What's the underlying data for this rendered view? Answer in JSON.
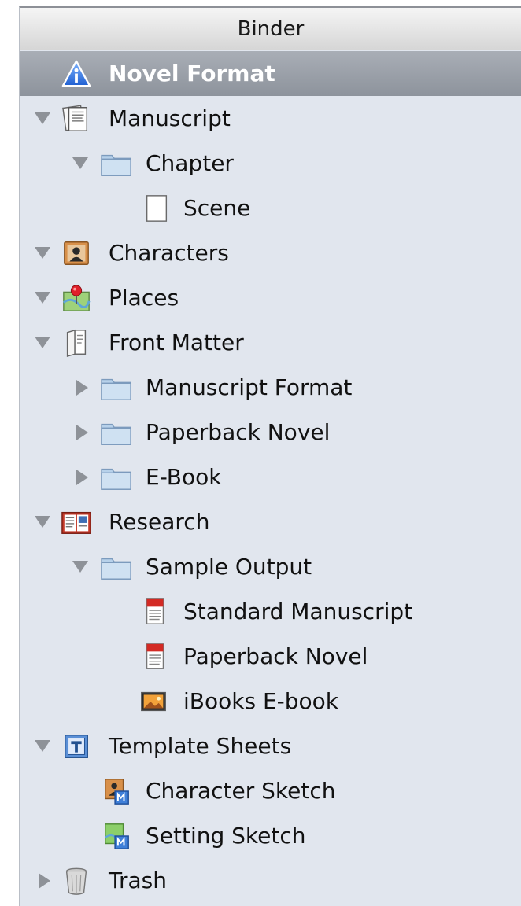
{
  "header": {
    "title": "Binder"
  },
  "items": [
    {
      "label": "Novel Format",
      "icon": "info-warning-icon",
      "selected": true
    },
    {
      "label": "Manuscript",
      "icon": "manuscript-icon",
      "expanded": true
    },
    {
      "label": "Chapter",
      "icon": "folder-icon",
      "expanded": true
    },
    {
      "label": "Scene",
      "icon": "document-icon"
    },
    {
      "label": "Characters",
      "icon": "character-card-icon",
      "expanded": true
    },
    {
      "label": "Places",
      "icon": "map-pin-icon",
      "expanded": true
    },
    {
      "label": "Front Matter",
      "icon": "front-matter-icon",
      "expanded": true
    },
    {
      "label": "Manuscript Format",
      "icon": "folder-icon",
      "expanded": false
    },
    {
      "label": "Paperback Novel",
      "icon": "folder-icon",
      "expanded": false
    },
    {
      "label": "E-Book",
      "icon": "folder-icon",
      "expanded": false
    },
    {
      "label": "Research",
      "icon": "research-icon",
      "expanded": true
    },
    {
      "label": "Sample Output",
      "icon": "folder-icon",
      "expanded": true
    },
    {
      "label": "Standard Manuscript",
      "icon": "pdf-icon"
    },
    {
      "label": "Paperback Novel",
      "icon": "pdf-icon"
    },
    {
      "label": "iBooks E-book",
      "icon": "image-icon"
    },
    {
      "label": "Template Sheets",
      "icon": "template-icon",
      "expanded": true
    },
    {
      "label": "Character Sketch",
      "icon": "character-sketch-icon"
    },
    {
      "label": "Setting Sketch",
      "icon": "setting-sketch-icon"
    },
    {
      "label": "Trash",
      "icon": "trash-icon",
      "expanded": false
    }
  ]
}
